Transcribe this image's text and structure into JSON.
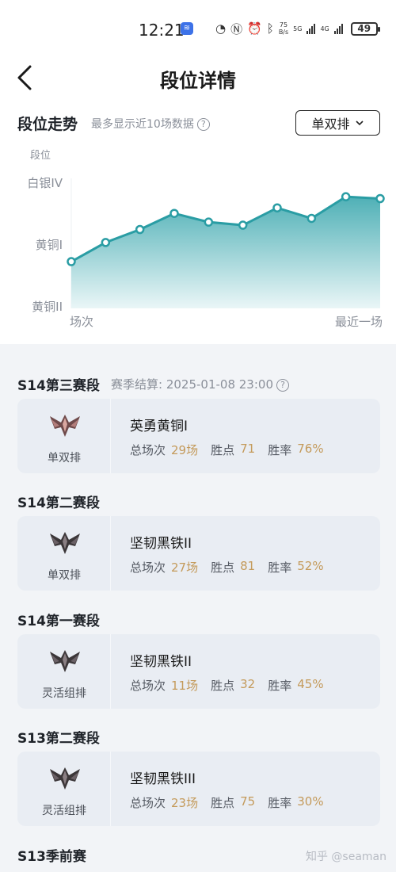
{
  "status": {
    "time": "12:21",
    "speed_top": "75",
    "speed_bottom": "B/s",
    "net1": "5G",
    "net2": "4G",
    "battery": "49"
  },
  "nav": {
    "title": "段位详情"
  },
  "trend": {
    "title": "段位走势",
    "subtitle": "最多显示近10场数据",
    "queue": "单双排",
    "ylabel": "段位",
    "x_start": "场次",
    "x_end": "最近一场"
  },
  "chart_data": {
    "type": "area",
    "ylabel": "段位",
    "xlabel_left": "场次",
    "xlabel_right": "最近一场",
    "yticks": [
      "黄铜II",
      "黄铜I",
      "白银IV"
    ],
    "yrange": [
      0,
      2
    ],
    "values": [
      0.73,
      1.04,
      1.25,
      1.51,
      1.37,
      1.32,
      1.6,
      1.43,
      1.78,
      1.75
    ],
    "colors": {
      "line": "#2a9da4",
      "fill_top": "#4fb0b6",
      "fill_bottom": "#eaf6f7"
    }
  },
  "seasons": [
    {
      "title": "S14第三赛段",
      "note": "赛季结算: 2025-01-08 23:00",
      "queue": "单双排",
      "rank": "英勇黄铜I",
      "games_label": "总场次",
      "games": "29场",
      "lp_label": "胜点",
      "lp": "71",
      "wr_label": "胜率",
      "wr": "76%",
      "emblem": "bronze-emblem-icon"
    },
    {
      "title": "S14第二赛段",
      "note": "",
      "queue": "单双排",
      "rank": "坚韧黑铁II",
      "games_label": "总场次",
      "games": "27场",
      "lp_label": "胜点",
      "lp": "81",
      "wr_label": "胜率",
      "wr": "52%",
      "emblem": "iron-emblem-icon"
    },
    {
      "title": "S14第一赛段",
      "note": "",
      "queue": "灵活组排",
      "rank": "坚韧黑铁II",
      "games_label": "总场次",
      "games": "11场",
      "lp_label": "胜点",
      "lp": "32",
      "wr_label": "胜率",
      "wr": "45%",
      "emblem": "iron-emblem-icon"
    },
    {
      "title": "S13第二赛段",
      "note": "",
      "queue": "灵活组排",
      "rank": "坚韧黑铁III",
      "games_label": "总场次",
      "games": "23场",
      "lp_label": "胜点",
      "lp": "75",
      "wr_label": "胜率",
      "wr": "30%",
      "emblem": "iron-emblem-icon"
    },
    {
      "title": "S13季前赛",
      "note": ""
    }
  ],
  "watermark": "知乎 @seaman"
}
